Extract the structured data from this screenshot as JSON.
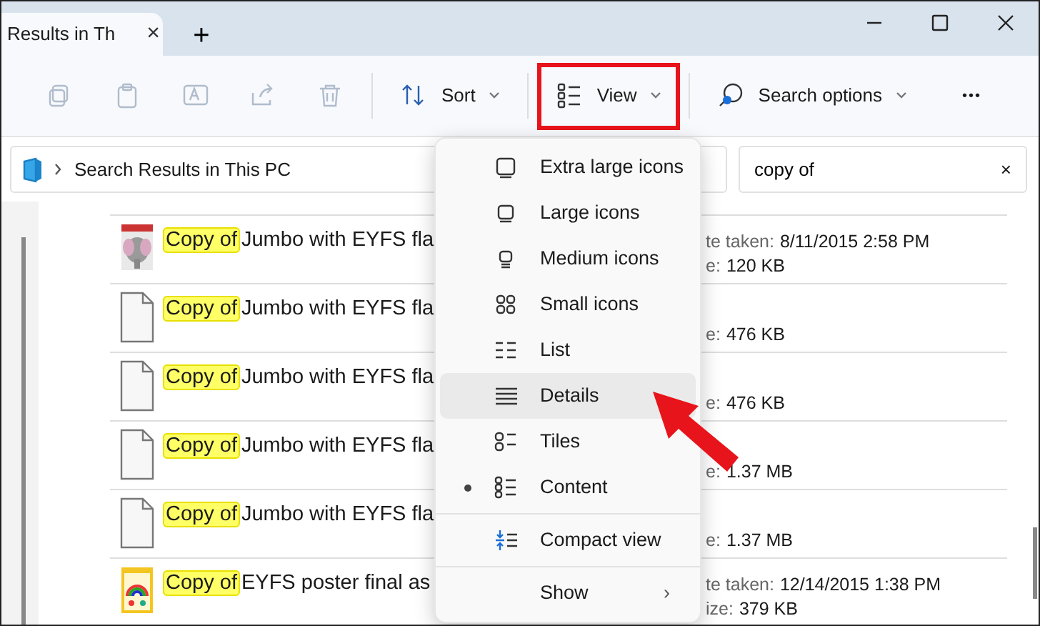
{
  "tabs": [
    {
      "label": "Results in Th",
      "close": "×",
      "selected": true
    }
  ],
  "new_tab": "+",
  "toolbar": {
    "icon_buttons": [
      {
        "kind": "copy",
        "disabled": true
      },
      {
        "kind": "paste",
        "disabled": true
      },
      {
        "kind": "rename",
        "disabled": true
      },
      {
        "kind": "share",
        "disabled": true
      },
      {
        "kind": "delete",
        "disabled": true
      }
    ],
    "buttons": [
      {
        "kind": "sort",
        "label": "Sort",
        "highlighted": false
      },
      {
        "kind": "view",
        "label": "View",
        "highlighted": true
      },
      {
        "kind": "search",
        "label": "Search options",
        "highlighted": false
      }
    ],
    "more": "•••"
  },
  "address": {
    "location": "Search Results in This PC"
  },
  "search": {
    "value": "copy of",
    "clear": "×"
  },
  "rows": [
    {
      "kind": "picture",
      "match": "Copy of",
      "name": "Jumbo with EYFS fla",
      "date_label": "te taken:",
      "date": "8/11/2015 2:58 PM",
      "size_label": "e:",
      "size": "120 KB"
    },
    {
      "kind": "file",
      "match": "Copy of",
      "name": "Jumbo with EYFS fla",
      "size_label": "e:",
      "size": "476 KB"
    },
    {
      "kind": "file",
      "match": "Copy of",
      "name": "Jumbo with EYFS fla",
      "size_label": "e:",
      "size": "476 KB"
    },
    {
      "kind": "file",
      "match": "Copy of",
      "name": "Jumbo with EYFS fla",
      "size_label": "e:",
      "size": "1.37 MB"
    },
    {
      "kind": "file",
      "match": "Copy of",
      "name": "Jumbo with EYFS fla",
      "size_label": "e:",
      "size": "1.37 MB"
    },
    {
      "kind": "picture",
      "match": "Copy of",
      "name": "EYFS poster final as",
      "date_label": "te taken:",
      "date": "12/14/2015 1:38 PM",
      "size_label": "ize:",
      "size": "379 KB"
    }
  ],
  "menu": [
    {
      "kind": "xl",
      "label": "Extra large icons",
      "selected": false,
      "hovered": false
    },
    {
      "kind": "large",
      "label": "Large icons",
      "selected": false,
      "hovered": false
    },
    {
      "kind": "medium",
      "label": "Medium icons",
      "selected": false,
      "hovered": false
    },
    {
      "kind": "small",
      "label": "Small icons",
      "selected": false,
      "hovered": false
    },
    {
      "kind": "list",
      "label": "List",
      "selected": false,
      "hovered": false
    },
    {
      "kind": "details",
      "label": "Details",
      "selected": false,
      "hovered": true
    },
    {
      "kind": "tiles",
      "label": "Tiles",
      "selected": false,
      "hovered": false
    },
    {
      "kind": "content",
      "label": "Content",
      "selected": true,
      "hovered": false
    },
    {
      "kind": "separator"
    },
    {
      "kind": "compact",
      "label": "Compact view",
      "selected": false,
      "hovered": false
    },
    {
      "kind": "separator"
    },
    {
      "kind": "submenu",
      "label": "Show",
      "chevron": "›"
    }
  ],
  "annotations": [
    {
      "kind": "arrow"
    }
  ]
}
